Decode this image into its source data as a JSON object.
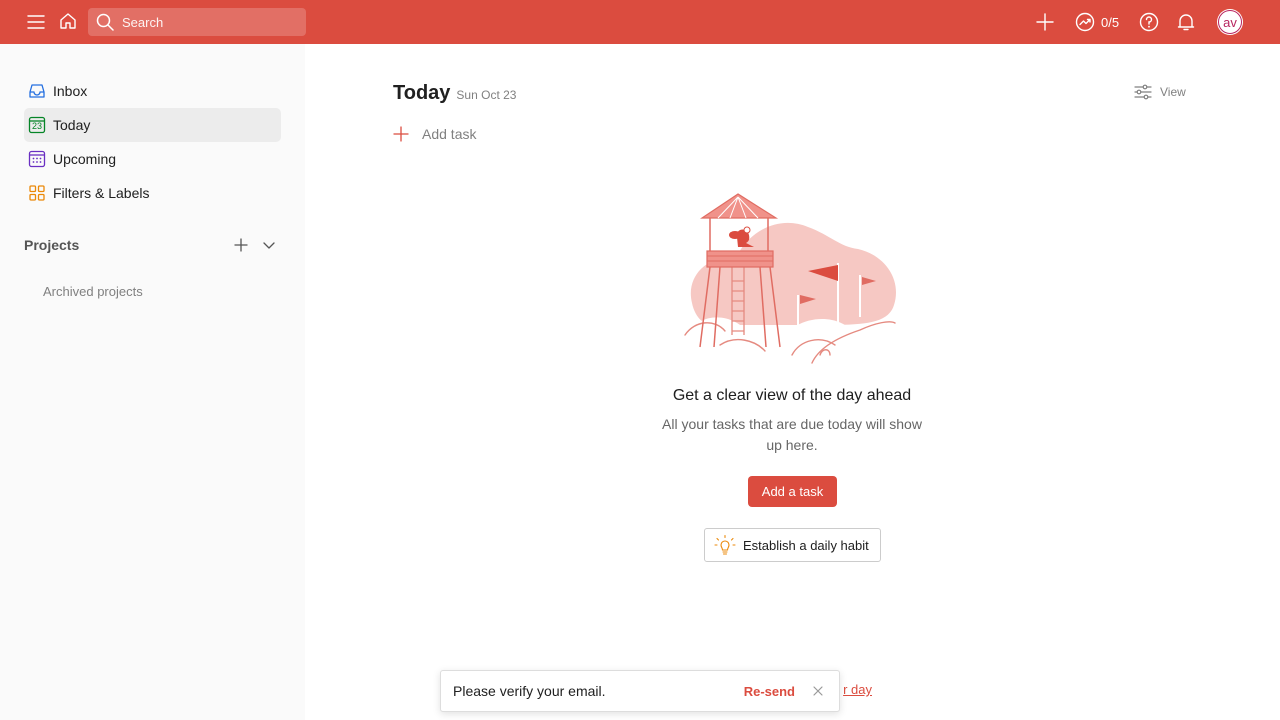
{
  "topbar": {
    "search_placeholder": "Search",
    "karma_text": "0/5",
    "avatar_initials": "av",
    "background_color": "#db4c3f"
  },
  "sidebar": {
    "items": [
      {
        "label": "Inbox",
        "icon": "inbox-icon",
        "color": "#246fe0"
      },
      {
        "label": "Today",
        "icon": "calendar-today-icon",
        "icon_text": "23",
        "color": "#058527",
        "active": true
      },
      {
        "label": "Upcoming",
        "icon": "calendar-grid-icon",
        "color": "#692fc2"
      },
      {
        "label": "Filters & Labels",
        "icon": "filters-icon",
        "color": "#eb8909"
      }
    ],
    "projects_label": "Projects",
    "archived_label": "Archived projects"
  },
  "main": {
    "title": "Today",
    "date": "Sun Oct 23",
    "view_label": "View",
    "add_task_label": "Add task",
    "empty_title": "Get a clear view of the day ahead",
    "empty_desc": "All your tasks that are due today will show up here.",
    "add_a_task_label": "Add a task",
    "habit_label": "Establish a daily habit",
    "background_link": "r day"
  },
  "toast": {
    "message": "Please verify your email.",
    "resend_label": "Re-send"
  }
}
